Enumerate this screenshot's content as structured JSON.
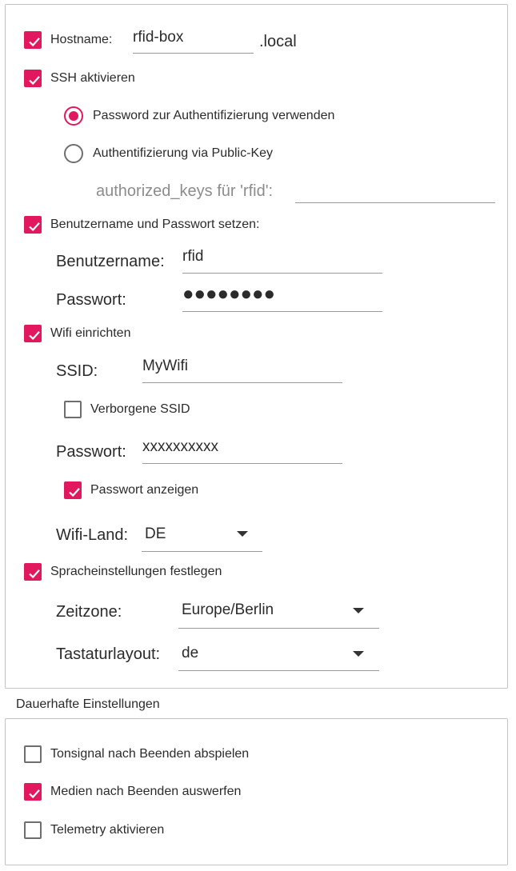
{
  "colors": {
    "accent": "#e2185e",
    "border": "#c4c4c4"
  },
  "hostname": {
    "label": "Hostname:",
    "value": "rfid-box",
    "suffix": ".local",
    "checked": true
  },
  "ssh": {
    "label": "SSH aktivieren",
    "checked": true,
    "radio_password": "Password zur Authentifizierung verwenden",
    "radio_pubkey": "Authentifizierung via Public-Key",
    "authorized_keys_label": "authorized_keys für 'rfid':",
    "authorized_keys_value": ""
  },
  "user": {
    "label": "Benutzername und Passwort setzen:",
    "checked": true,
    "username_label": "Benutzername:",
    "username_value": "rfid",
    "password_label": "Passwort:",
    "password_value": "●●●●●●●●"
  },
  "wifi": {
    "label": "Wifi einrichten",
    "checked": true,
    "ssid_label": "SSID:",
    "ssid_value": "MyWifi",
    "hidden_label": "Verborgene SSID",
    "hidden_checked": false,
    "password_label": "Passwort:",
    "password_value": "xxxxxxxxxx",
    "show_password_label": "Passwort anzeigen",
    "show_password_checked": true,
    "country_label": "Wifi-Land:",
    "country_value": "DE"
  },
  "locale": {
    "label": "Spracheinstellungen festlegen",
    "checked": true,
    "timezone_label": "Zeitzone:",
    "timezone_value": "Europe/Berlin",
    "keyboard_label": "Tastaturlayout:",
    "keyboard_value": "de"
  },
  "persistent": {
    "title": "Dauerhafte Einstellungen",
    "items": [
      {
        "label": "Tonsignal nach Beenden abspielen",
        "checked": false
      },
      {
        "label": "Medien nach Beenden auswerfen",
        "checked": true
      },
      {
        "label": "Telemetry aktivieren",
        "checked": false
      }
    ]
  }
}
